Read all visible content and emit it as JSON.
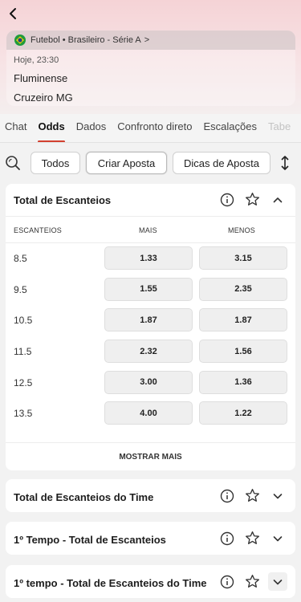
{
  "header": {
    "league": "Futebol • Brasileiro - Série A",
    "league_chevron": ">",
    "kickoff": "Hoje, 23:30",
    "home_team": "Fluminense",
    "away_team": "Cruzeiro MG"
  },
  "tabs": [
    {
      "label": "Chat"
    },
    {
      "label": "Odds"
    },
    {
      "label": "Dados"
    },
    {
      "label": "Confronto direto"
    },
    {
      "label": "Escalações"
    },
    {
      "label": "Tabe"
    }
  ],
  "filters": {
    "todos": "Todos",
    "criar": "Criar Aposta",
    "dicas": "Dicas de Aposta"
  },
  "market": {
    "title": "Total de Escanteios",
    "col_line": "ESCANTEIOS",
    "col_over": "MAIS",
    "col_under": "MENOS",
    "rows": [
      {
        "line": "8.5",
        "over": "1.33",
        "under": "3.15"
      },
      {
        "line": "9.5",
        "over": "1.55",
        "under": "2.35"
      },
      {
        "line": "10.5",
        "over": "1.87",
        "under": "1.87"
      },
      {
        "line": "11.5",
        "over": "2.32",
        "under": "1.56"
      },
      {
        "line": "12.5",
        "over": "3.00",
        "under": "1.36"
      },
      {
        "line": "13.5",
        "over": "4.00",
        "under": "1.22"
      }
    ],
    "show_more": "MOSTRAR MAIS"
  },
  "collapsed_markets": [
    {
      "title": "Total de Escanteios do Time"
    },
    {
      "title": "1º Tempo - Total de Escanteios"
    },
    {
      "title": "1º tempo - Total de Escanteios do Time"
    }
  ],
  "colors": {
    "accent": "#d2402f",
    "header_gradient_top": "#f5d3d6"
  },
  "icons": [
    "back-arrow-icon",
    "brazil-flag-icon",
    "search-icon",
    "sort-icon",
    "info-icon",
    "star-icon",
    "chevron-up-icon",
    "chevron-down-icon"
  ]
}
